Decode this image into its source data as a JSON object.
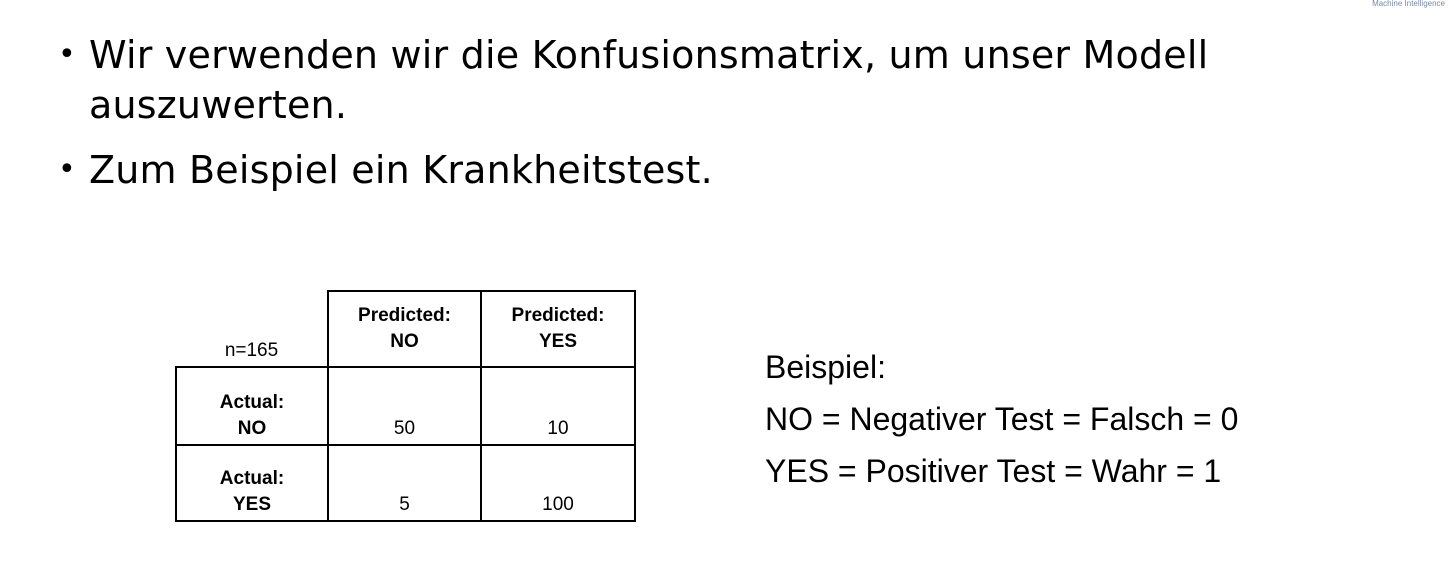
{
  "corner_mark": "Machine Intelligence",
  "bullets": [
    {
      "line1": "Wir verwenden wir die Konfusionsmatrix, um unser Modell",
      "line2": "auszuwerten."
    },
    {
      "line1": "Zum Beispiel ein Krankheitstest.",
      "line2": ""
    }
  ],
  "matrix": {
    "n_label": "n=165",
    "col_headers": [
      {
        "line1": "Predicted:",
        "line2": "NO"
      },
      {
        "line1": "Predicted:",
        "line2": "YES"
      }
    ],
    "rows": [
      {
        "line1": "Actual:",
        "line2": "NO",
        "values": [
          "50",
          "10"
        ]
      },
      {
        "line1": "Actual:",
        "line2": "YES",
        "values": [
          "5",
          "100"
        ]
      }
    ]
  },
  "legend": {
    "title": "Beispiel:",
    "lines": [
      "NO = Negativer Test = Falsch = 0",
      "YES = Positiver Test = Wahr = 1"
    ]
  }
}
